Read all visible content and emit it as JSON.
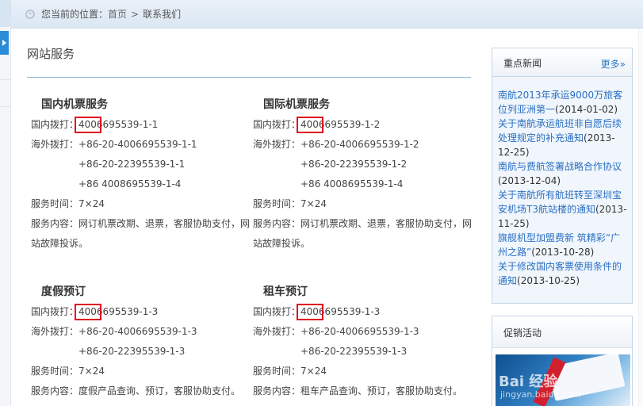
{
  "breadcrumb": {
    "prefix": "您当前的位置：",
    "home": "首页",
    "separator": ">",
    "current": "联系我们"
  },
  "main": {
    "section_title": "网站服务",
    "services": [
      {
        "title": "国内机票服务",
        "domestic_label": "国内拨打：",
        "domestic_phone": "4006695539-1-1",
        "overseas_label": "海外拨打：",
        "overseas_phones": [
          "+86-20-4006695539-1-1",
          "+86-20-22395539-1-1",
          "+86 4008695539-1-4"
        ],
        "hours_label": "服务时间：",
        "hours": "7×24",
        "content_label": "服务内容：",
        "content": "网订机票改期、退票，客服协助支付，网站故障投诉。"
      },
      {
        "title": "国际机票服务",
        "domestic_label": "国内拨打：",
        "domestic_phone": "4006695539-1-2",
        "overseas_label": "海外拨打：",
        "overseas_phones": [
          "+86-20-4006695539-1-2",
          "+86-20-22395539-1-2",
          "+86 4008695539-1-4"
        ],
        "hours_label": "服务时间：",
        "hours": "7×24",
        "content_label": "服务内容：",
        "content": "网订机票改期、退票，客服协助支付，网站故障投诉。"
      },
      {
        "title": "度假预订",
        "domestic_label": "国内拨打：",
        "domestic_phone": "4006695539-1-3",
        "overseas_label": "海外拨打：",
        "overseas_phones": [
          "+86-20-4006695539-1-3",
          "+86-20-22395539-1-3"
        ],
        "hours_label": "服务时间：",
        "hours": "7×24",
        "content_label": "服务内容：",
        "content": "度假产品查询、预订，客服协助支付。"
      },
      {
        "title": "租车预订",
        "domestic_label": "国内拨打：",
        "domestic_phone": "4006695539-1-3",
        "overseas_label": "海外拨打：",
        "overseas_phones": [
          "+86-20-4006695539-1-3",
          "+86-20-22395539-1-3"
        ],
        "hours_label": "服务时间：",
        "hours": "7×24",
        "content_label": "服务内容：",
        "content": "租车产品查询、预订，客服协助支付。"
      }
    ]
  },
  "sidebar": {
    "news": {
      "title": "重点新闻",
      "more": "更多»",
      "items": [
        {
          "link": "南航2013年承运9000万旅客位列亚洲第一",
          "date": "(2014-01-02)"
        },
        {
          "link": "关于南航承运航班非自愿后续处理规定的补充通知",
          "date": "(2013-12-25)"
        },
        {
          "link": "南航与费航签署战略合作协议",
          "date": "(2013-12-04)"
        },
        {
          "link": "关于南航所有航班转至深圳宝安机场T3航站楼的通知",
          "date": "(2013-11-25)"
        },
        {
          "link": "旗舰机型加盟费新 筑精彩“广州之路”",
          "date": "(2013-10-28)"
        },
        {
          "link": "关于修改国内客票使用条件的通知",
          "date": "(2013-10-25)"
        }
      ]
    },
    "promo": {
      "title": "促销活动",
      "watermark": "Bai 经验",
      "watermark_sub": "jingyan.baidu.com"
    }
  },
  "highlight_color": "#e0131f"
}
